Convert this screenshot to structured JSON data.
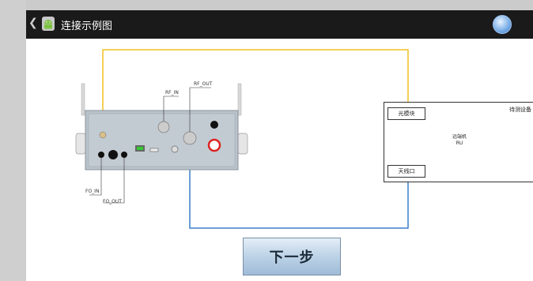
{
  "titlebar": {
    "title": "连接示例图",
    "back_icon": "chevron-left-icon",
    "app_icon": "android-icon",
    "home_icon": "home-icon"
  },
  "diagram": {
    "labels": {
      "rf_in": "RF_IN",
      "rf_out": "RF_OUT",
      "fo_in": "FO_IN",
      "fo_out": "FO_OUT"
    },
    "device": {
      "title": "待测设备",
      "optical_port": "光模块",
      "center_line1": "远端机",
      "center_line2": "RU",
      "antenna_port": "天线口"
    },
    "colors": {
      "fiber": "#f0c020",
      "rf": "#3a7fc8"
    }
  },
  "footer": {
    "next_label": "下一步"
  }
}
